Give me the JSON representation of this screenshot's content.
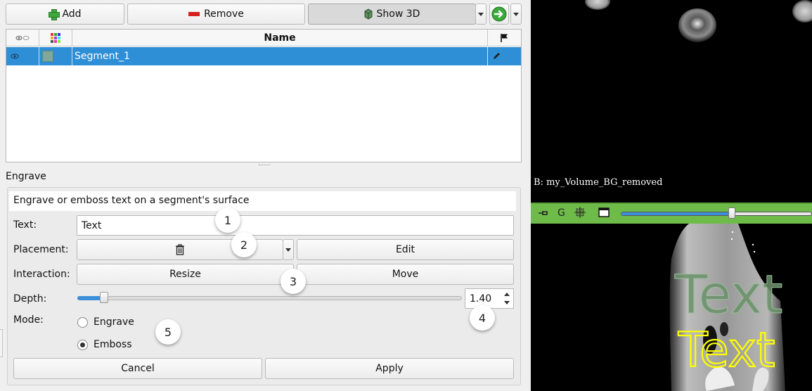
{
  "toolbar": {
    "add_label": "Add",
    "remove_label": "Remove",
    "show3d_label": "Show 3D"
  },
  "segments_table": {
    "headers": {
      "name": "Name"
    },
    "rows": [
      {
        "name": "Segment_1",
        "color": "#7fa898"
      }
    ]
  },
  "engrave": {
    "section_title": "Engrave",
    "description": "Engrave or emboss text on a segment's surface",
    "text_label": "Text:",
    "text_value": "Text",
    "placement_label": "Placement:",
    "edit_label": "Edit",
    "interaction_label": "Interaction:",
    "resize_label": "Resize",
    "move_label": "Move",
    "depth_label": "Depth:",
    "depth_value": "1.40",
    "depth_fraction": 0.07,
    "mode_label": "Mode:",
    "mode_options": [
      "Engrave",
      "Emboss"
    ],
    "mode_selected": "Emboss",
    "cancel_label": "Cancel",
    "apply_label": "Apply"
  },
  "callouts": [
    "1",
    "2",
    "3",
    "4",
    "5"
  ],
  "viewers": {
    "top_caption": "B: my_Volume_BG_removed",
    "bar_g_label": "G",
    "slider_fraction": 0.58,
    "overlay_text_green": "Text",
    "overlay_text_yellow": "Text",
    "bar_color": "#6fbb4a"
  }
}
